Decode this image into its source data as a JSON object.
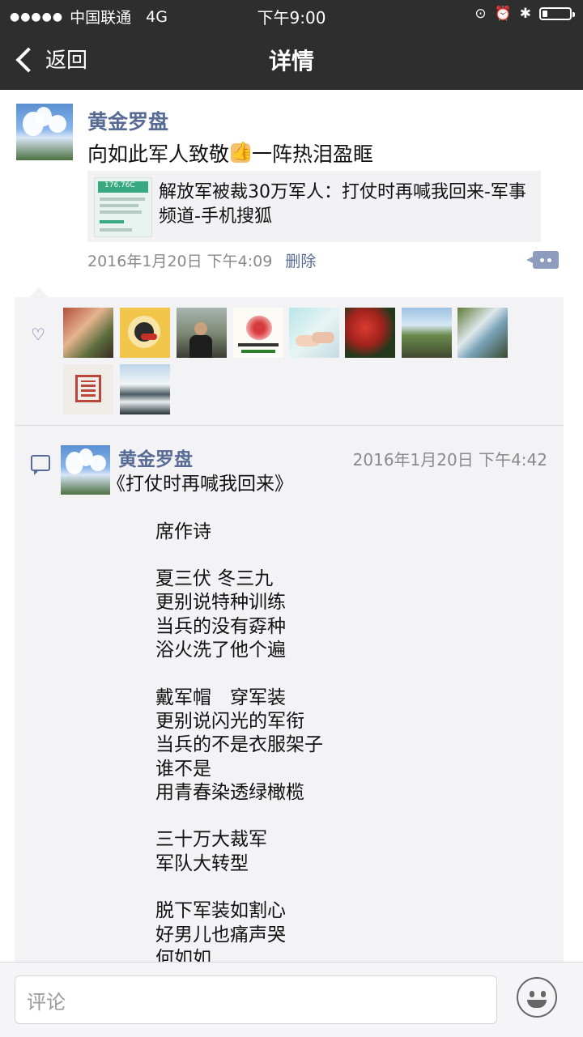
{
  "status_bar": {
    "carrier": "中国联通",
    "network": "4G",
    "time": "下午9:00"
  },
  "nav": {
    "back_label": "返回",
    "title": "详情"
  },
  "post": {
    "username": "黄金罗盘",
    "text_before": "向如此军人致敬",
    "text_after": "一阵热泪盈眶",
    "link": {
      "title": "解放军被裁30万军人：打仗时再喊我回来-军事频道-手机搜狐",
      "thumb_text": "176.76C"
    },
    "timestamp": "2016年1月20日 下午4:09",
    "delete_label": "删除"
  },
  "likes": {
    "count": 10
  },
  "comment": {
    "username": "黄金罗盘",
    "time": "2016年1月20日 下午4:42",
    "lines": [
      "《打仗时再喊我回来》",
      "",
      "　　席作诗",
      "",
      "　　夏三伏  冬三九",
      "　　更别说特种训练",
      "　　当兵的没有孬种",
      "　　浴火洗了他个遍",
      "",
      "　　戴军帽　穿军装",
      "　　更别说闪光的军衔",
      "　　当兵的不是衣服架子",
      "　　谁不是",
      "　　用青春染透绿橄榄",
      "",
      "　　三十万大裁军",
      "　　军队大转型",
      "",
      "　　脱下军装如割心",
      "　　好男儿也痛声哭",
      "　　何如如"
    ]
  },
  "input": {
    "placeholder": "评论"
  },
  "colors": {
    "bar_bg": "#2e2e2e",
    "link_blue": "#576b95",
    "panel_bg": "#f3f3f5"
  }
}
